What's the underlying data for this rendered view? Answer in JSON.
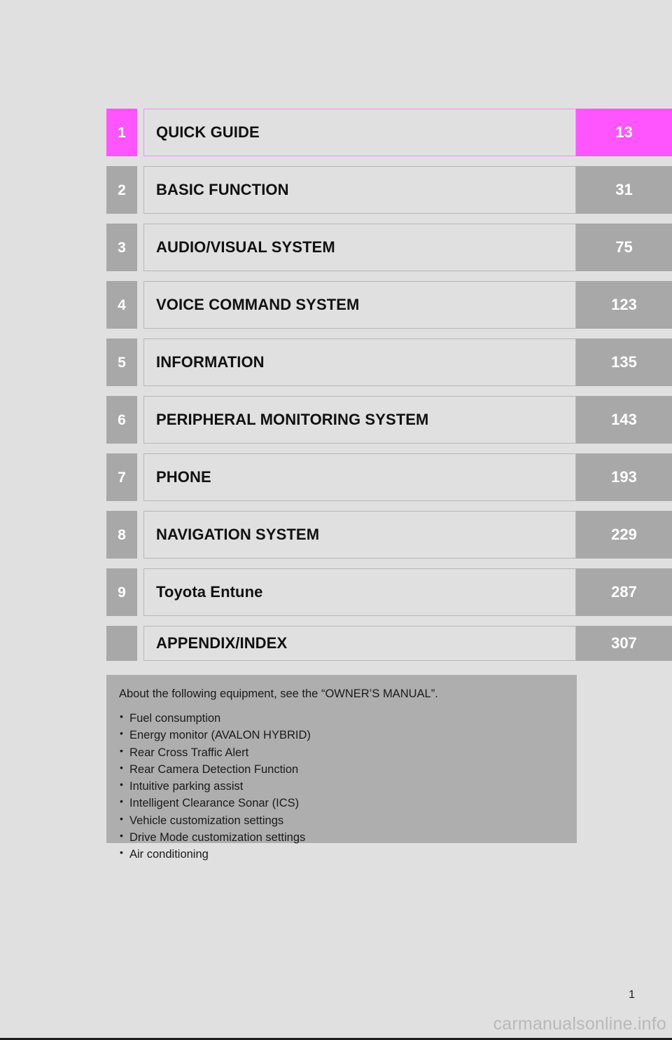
{
  "document": {
    "type": "table-of-contents",
    "folio": "1",
    "watermark": "carmanualsonline.info",
    "colors": {
      "page_background": "#e0e0e0",
      "block_gray": "#a8a8a8",
      "highlight_magenta": "#ff55ff",
      "note_gray": "#aeaeae",
      "plate_border": "#b6b6b6"
    }
  },
  "chapters": [
    {
      "number": "1",
      "title": "QUICK GUIDE",
      "page": "13",
      "highlighted": true
    },
    {
      "number": "2",
      "title": "BASIC FUNCTION",
      "page": "31",
      "highlighted": false
    },
    {
      "number": "3",
      "title": "AUDIO/VISUAL SYSTEM",
      "page": "75",
      "highlighted": false
    },
    {
      "number": "4",
      "title": "VOICE COMMAND SYSTEM",
      "page": "123",
      "highlighted": false
    },
    {
      "number": "5",
      "title": "INFORMATION",
      "page": "135",
      "highlighted": false
    },
    {
      "number": "6",
      "title": "PERIPHERAL MONITORING SYSTEM",
      "page": "143",
      "highlighted": false
    },
    {
      "number": "7",
      "title": "PHONE",
      "page": "193",
      "highlighted": false
    },
    {
      "number": "8",
      "title": "NAVIGATION SYSTEM",
      "page": "229",
      "highlighted": false
    },
    {
      "number": "9",
      "title": "Toyota Entune",
      "page": "287",
      "highlighted": false
    },
    {
      "number": "",
      "title": "APPENDIX/INDEX",
      "page": "307",
      "highlighted": false
    }
  ],
  "note": {
    "heading": "About the following equipment, see the “OWNER’S MANUAL”.",
    "items": [
      "Fuel consumption",
      "Energy monitor (AVALON HYBRID)",
      "Rear Cross Traffic Alert",
      "Rear Camera Detection Function",
      "Intuitive parking assist",
      "Intelligent Clearance Sonar (ICS)",
      "Vehicle customization settings",
      "Drive Mode customization settings",
      "Air conditioning"
    ]
  }
}
